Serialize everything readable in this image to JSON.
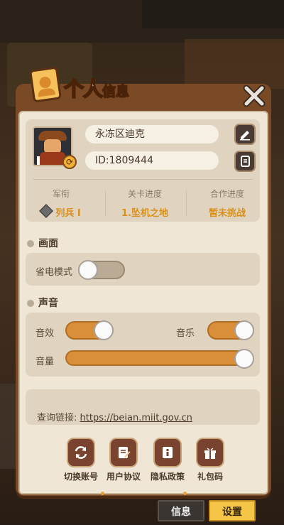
{
  "header": {
    "title_big": "个人",
    "title_small": "信息"
  },
  "profile": {
    "name": "永冻区迪克",
    "id": "ID:1809444"
  },
  "stats": [
    {
      "label": "军衔",
      "value": "列兵 I"
    },
    {
      "label": "关卡进度",
      "value": "1.坠机之地"
    },
    {
      "label": "合作进度",
      "value": "暂未挑战"
    }
  ],
  "display_section": {
    "title": "画面",
    "power_save_label": "省电模式",
    "power_save_on": false
  },
  "sound_section": {
    "title": "声音",
    "sfx_label": "音效",
    "sfx_on": true,
    "music_label": "音乐",
    "music_on": true,
    "volume_label": "音量",
    "volume_level": 1.0
  },
  "link": {
    "label": "查询链接:",
    "url": "https://beian.miit.gov.cn"
  },
  "actions": [
    {
      "label": "切换账号",
      "icon": "switch-account-icon"
    },
    {
      "label": "用户协议",
      "icon": "user-agreement-icon"
    },
    {
      "label": "隐私政策",
      "icon": "privacy-policy-icon"
    },
    {
      "label": "礼包码",
      "icon": "gift-icon"
    }
  ],
  "tabs": [
    {
      "label": "信息",
      "active": false
    },
    {
      "label": "设置",
      "active": true
    }
  ],
  "colors": {
    "accent": "#d98e3a",
    "highlight": "#d8901c",
    "panel": "#7a4a26",
    "active_tab": "#f4c547"
  }
}
